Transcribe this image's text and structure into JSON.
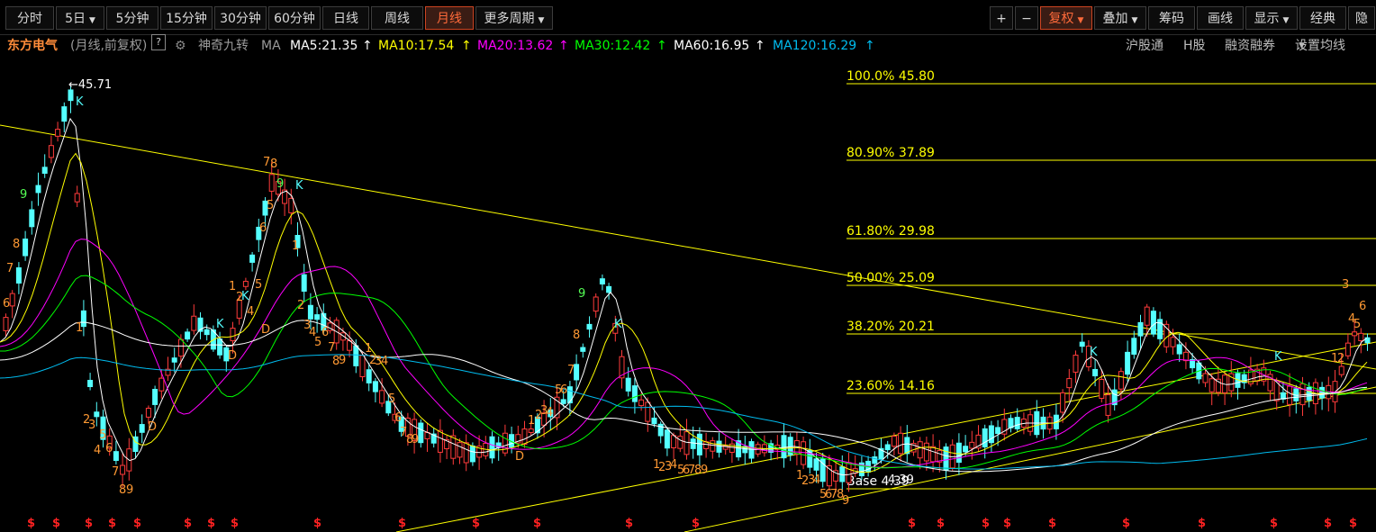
{
  "toolbar": {
    "left_buttons": [
      "分时",
      "5日",
      "5分钟",
      "15分钟",
      "30分钟",
      "60分钟",
      "日线",
      "周线",
      "月线",
      "更多周期"
    ],
    "active": "月线",
    "right_buttons": [
      "+",
      "−",
      "复权",
      "叠加",
      "筹码",
      "画线",
      "显示",
      "经典",
      "隐"
    ]
  },
  "infobar": {
    "stock_name": "东方电气",
    "period_label": "(月线,前复权)",
    "help": "?",
    "indicator": "神奇九转",
    "ma_label": "MA",
    "ma5": "MA5:21.35",
    "ma10": "MA10:17.54",
    "ma20": "MA20:13.62",
    "ma30": "MA30:12.42",
    "ma60": "MA60:16.95",
    "ma120": "MA120:16.29",
    "arrow": "↑",
    "right_links": [
      "沪股通",
      "H股",
      "融资融券",
      "设置均线"
    ]
  },
  "colors": {
    "up": "#ff3b3b",
    "down": "#54ffff",
    "ma5": "#ffffff",
    "ma10": "#ffff00",
    "ma20": "#ff00ff",
    "ma30": "#00ff00",
    "ma60": "#ffffff",
    "ma120": "#00bbee",
    "fib": "#ffff00",
    "nine_orange": "#ff9933",
    "nine_green": "#55ff55",
    "signal": "#ff2222"
  },
  "chart_data": {
    "type": "candlestick",
    "y_range": [
      4.39,
      45.71
    ],
    "high_label": "←45.71",
    "low_label": "4.39",
    "fibonacci": [
      {
        "label": "100.0% 45.80",
        "value": 45.8
      },
      {
        "label": "80.90% 37.89",
        "value": 37.89
      },
      {
        "label": "61.80% 29.98",
        "value": 29.98
      },
      {
        "label": "50.00% 25.09",
        "value": 25.09
      },
      {
        "label": "38.20% 20.21",
        "value": 20.21
      },
      {
        "label": "23.60% 14.16",
        "value": 14.16
      },
      {
        "label": "Base 4.39",
        "value": 4.39
      }
    ],
    "signal_mark": "$",
    "nine_turn_labels": [
      "1",
      "2",
      "3",
      "4",
      "5",
      "6",
      "7",
      "8",
      "9",
      "K",
      "D"
    ]
  }
}
